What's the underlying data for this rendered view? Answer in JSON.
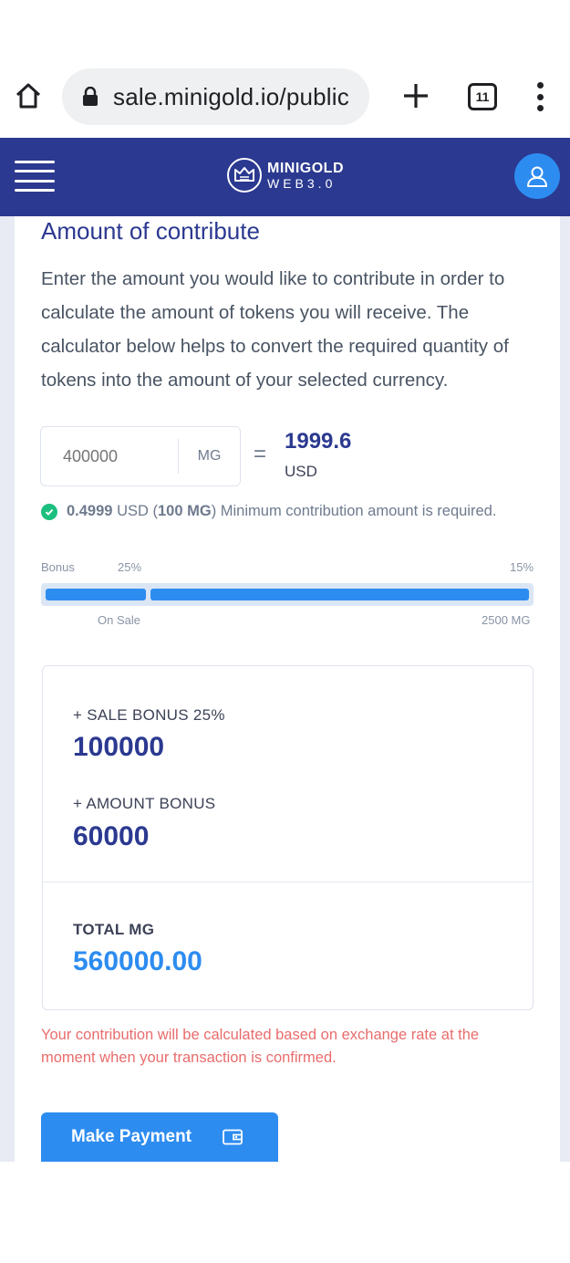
{
  "browser": {
    "url": "sale.minigold.io/public",
    "tab_count": "11"
  },
  "header": {
    "logo_line1": "MINIGOLD",
    "logo_line2": "WEB3.0"
  },
  "contribute": {
    "title": "Amount of contribute",
    "description": "Enter the amount you would like to contribute in order to calculate the amount of tokens you will receive. The calculator below helps to convert the required quantity of tokens into the amount of your selected currency.",
    "amount_placeholder": "400000",
    "unit": "MG",
    "equals": "=",
    "converted_value": "1999.6",
    "converted_currency": "USD",
    "min_price": "0.4999",
    "min_text_1": "USD (",
    "min_amount": "100 MG",
    "min_text_2": ") Minimum contribution amount is required."
  },
  "bonus_bar": {
    "label_bonus": "Bonus",
    "label_first_pct": "25%",
    "label_last_pct": "15%",
    "label_on_sale": "On Sale",
    "label_threshold": "2500 MG",
    "segments_percent": [
      21,
      79
    ]
  },
  "summary": {
    "sale_bonus_label": "+ SALE BONUS 25%",
    "sale_bonus_value": "100000",
    "amount_bonus_label": "+ AMOUNT BONUS",
    "amount_bonus_value": "60000",
    "total_label": "TOTAL MG",
    "total_value": "560000.00"
  },
  "disclaimer": "Your contribution will be calculated based on exchange rate at the moment when your transaction is confirmed.",
  "payment": {
    "button_label": "Make Payment"
  },
  "colors": {
    "navy": "#2b3990",
    "accent_blue": "#2d8cf0",
    "success_green": "#1cbf7e",
    "warning_red": "#e96c6c"
  }
}
